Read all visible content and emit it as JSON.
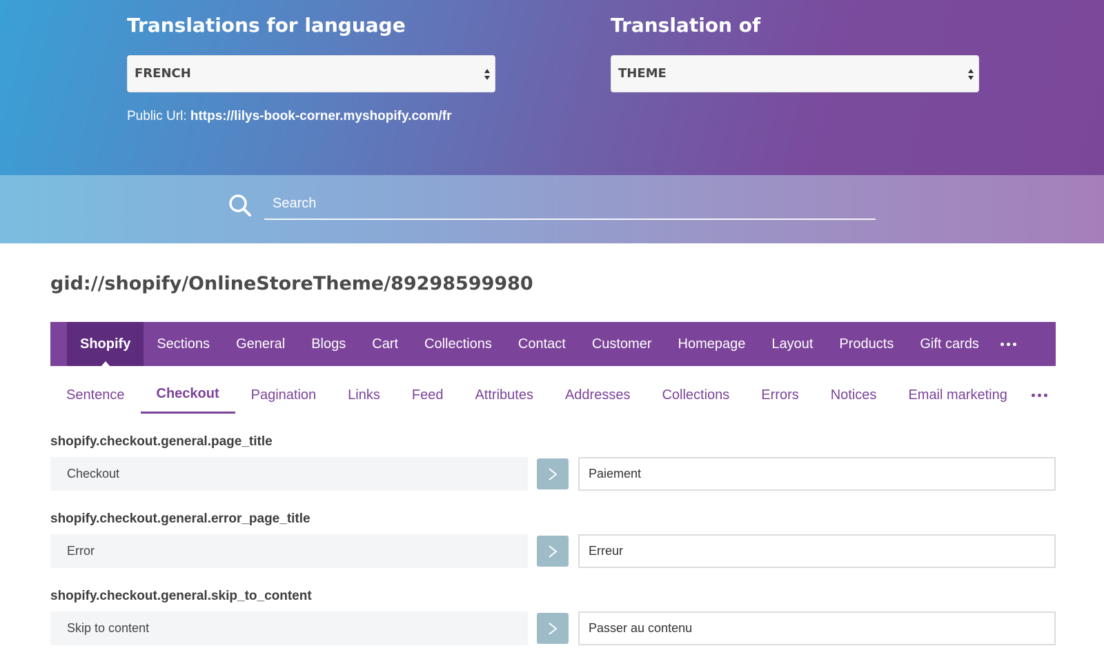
{
  "header": {
    "language_title": "Translations for language",
    "language_value": "FRENCH",
    "source_title": "Translation of",
    "source_value": "THEME",
    "public_url_label": "Public Url:",
    "public_url_value": "https://lilys-book-corner.myshopify.com/fr"
  },
  "search": {
    "placeholder": "Search"
  },
  "theme_id": "gid://shopify/OnlineStoreTheme/89298599980",
  "main_tabs": [
    {
      "label": "Shopify",
      "active": true
    },
    {
      "label": "Sections"
    },
    {
      "label": "General"
    },
    {
      "label": "Blogs"
    },
    {
      "label": "Cart"
    },
    {
      "label": "Collections"
    },
    {
      "label": "Contact"
    },
    {
      "label": "Customer"
    },
    {
      "label": "Homepage"
    },
    {
      "label": "Layout"
    },
    {
      "label": "Products"
    },
    {
      "label": "Gift cards"
    }
  ],
  "sub_tabs": [
    {
      "label": "Sentence"
    },
    {
      "label": "Checkout",
      "active": true
    },
    {
      "label": "Pagination"
    },
    {
      "label": "Links"
    },
    {
      "label": "Feed"
    },
    {
      "label": "Attributes"
    },
    {
      "label": "Addresses"
    },
    {
      "label": "Collections"
    },
    {
      "label": "Errors"
    },
    {
      "label": "Notices"
    },
    {
      "label": "Email marketing"
    }
  ],
  "rows": [
    {
      "key": "shopify.checkout.general.page_title",
      "source": "Checkout",
      "target": "Paiement"
    },
    {
      "key": "shopify.checkout.general.error_page_title",
      "source": "Error",
      "target": "Erreur"
    },
    {
      "key": "shopify.checkout.general.skip_to_content",
      "source": "Skip to content",
      "target": "Passer au contenu"
    }
  ],
  "colors": {
    "brand_purple": "#7b4399",
    "active_tab": "#5e2c7c",
    "copy_button": "#9dbcc8"
  },
  "icons": {
    "search": "search-icon",
    "more": "more-dots-icon",
    "select": "select-arrows-icon",
    "copy": "chevron-right-icon"
  }
}
